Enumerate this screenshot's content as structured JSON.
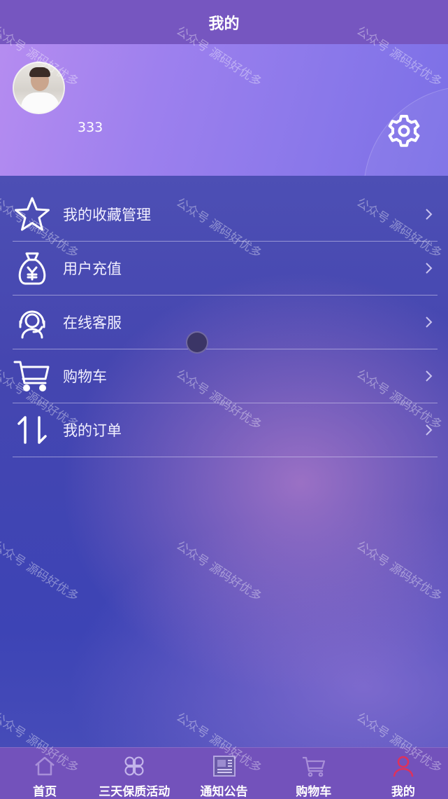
{
  "header": {
    "title": "我的"
  },
  "profile": {
    "username": "333"
  },
  "menu": {
    "items": [
      {
        "label": "我的收藏管理",
        "icon": "star-icon"
      },
      {
        "label": "用户充值",
        "icon": "money-bag-icon"
      },
      {
        "label": "在线客服",
        "icon": "customer-service-icon"
      },
      {
        "label": "购物车",
        "icon": "cart-icon"
      },
      {
        "label": "我的订单",
        "icon": "sort-arrows-icon"
      }
    ]
  },
  "tabbar": {
    "tabs": [
      {
        "label": "首页",
        "icon": "home-icon"
      },
      {
        "label": "三天保质活动",
        "icon": "clover-grid-icon"
      },
      {
        "label": "通知公告",
        "icon": "newspaper-icon"
      },
      {
        "label": "购物车",
        "icon": "cart-icon"
      },
      {
        "label": "我的",
        "icon": "user-icon"
      }
    ],
    "active_index": 4
  },
  "watermark": "公众号 源码好优多",
  "colors": {
    "header": "#7656c0",
    "tabbar": "#7352bb",
    "active_tab_icon": "#e0315a",
    "text": "#ffffff"
  }
}
